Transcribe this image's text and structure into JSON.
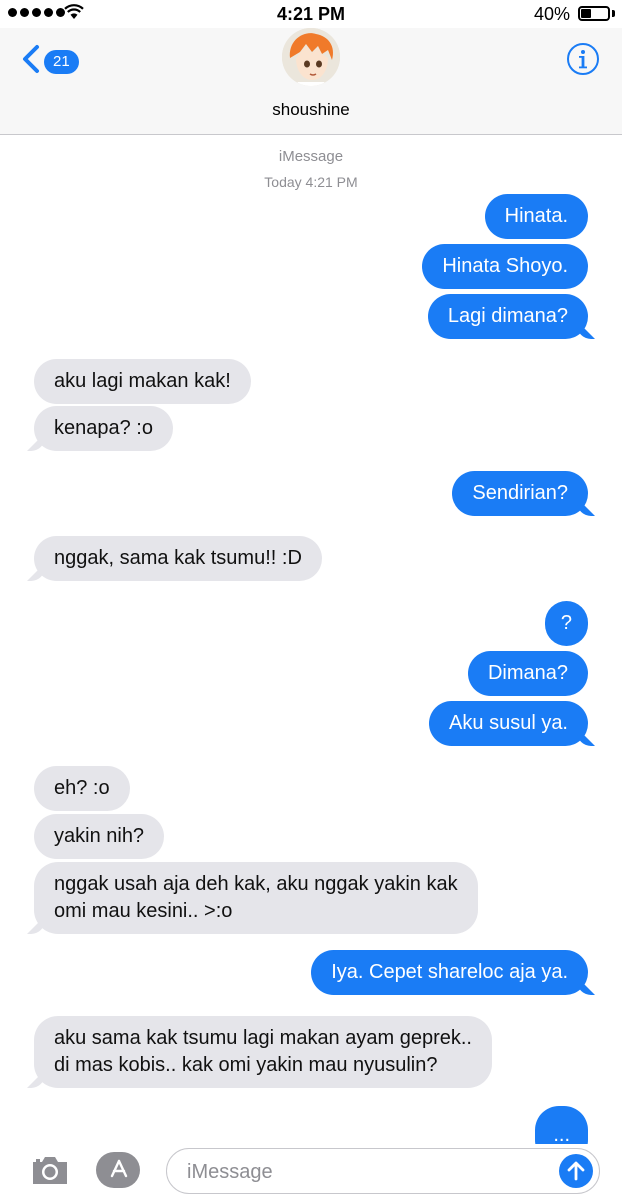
{
  "status_bar": {
    "time": "4:21 PM",
    "battery_percent": "40%",
    "battery_level": 0.4,
    "signal_bars": 5
  },
  "nav": {
    "back_count": "21",
    "contact_name": "shoushine",
    "back_icon": "chevron-left-icon",
    "info_icon": "info-icon"
  },
  "thread": {
    "service": "iMessage",
    "timestamp": "Today 4:21 PM",
    "messages": [
      {
        "dir": "out",
        "text": "Hinata."
      },
      {
        "dir": "out",
        "text": "Hinata Shoyo."
      },
      {
        "dir": "out",
        "text": "Lagi dimana?"
      },
      {
        "dir": "in",
        "text": "aku lagi makan kak!"
      },
      {
        "dir": "in",
        "text": "kenapa? :o"
      },
      {
        "dir": "out",
        "text": "Sendirian?"
      },
      {
        "dir": "in",
        "text": "nggak, sama kak tsumu!! :D"
      },
      {
        "dir": "out",
        "text": "?"
      },
      {
        "dir": "out",
        "text": "Dimana?"
      },
      {
        "dir": "out",
        "text": "Aku susul ya."
      },
      {
        "dir": "in",
        "text": "eh? :o"
      },
      {
        "dir": "in",
        "text": "yakin nih?"
      },
      {
        "dir": "in",
        "text": "nggak usah aja deh kak, aku nggak yakin kak\nomi mau kesini.. >:o"
      },
      {
        "dir": "out",
        "text": "Iya. Cepet shareloc aja ya."
      },
      {
        "dir": "in",
        "text": "aku sama kak tsumu lagi makan ayam geprek..\ndi mas kobis.. kak omi yakin mau nyusulin?"
      },
      {
        "dir": "out",
        "text": "..."
      }
    ]
  },
  "input_bar": {
    "placeholder": "iMessage",
    "value": "",
    "camera_icon": "camera-icon",
    "apps_icon": "app-store-icon",
    "send_icon": "arrow-up-icon"
  },
  "colors": {
    "accent": "#1a7cf5",
    "incoming_bubble": "#e5e5ea",
    "meta_text": "#8e8e93"
  }
}
